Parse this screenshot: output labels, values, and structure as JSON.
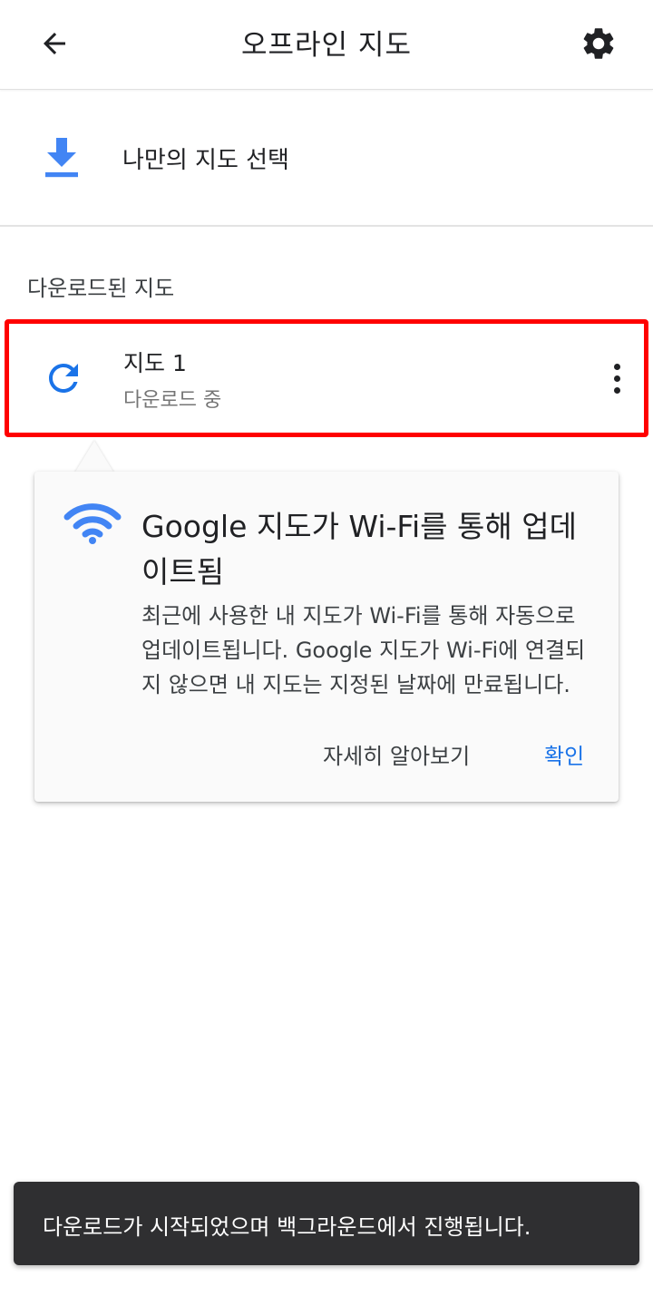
{
  "appbar": {
    "title": "오프라인 지도",
    "back_icon": "arrow-back-icon",
    "settings_icon": "gear-icon"
  },
  "select_row": {
    "icon": "download-icon",
    "label": "나만의 지도 선택"
  },
  "downloaded_section": {
    "heading": "다운로드된 지도",
    "items": [
      {
        "icon": "refresh-icon",
        "name": "지도 1",
        "status": "다운로드 중",
        "more_icon": "more-vert-icon"
      }
    ]
  },
  "info_card": {
    "icon": "wifi-icon",
    "title": "Google 지도가 Wi-Fi를 통해 업데이트됨",
    "body": "최근에 사용한 내 지도가 Wi-Fi를 통해 자동으로 업데이트됩니다. Google 지도가 Wi-Fi에 연결되지 않으면 내 지도는 지정된 날짜에 만료됩니다.",
    "learn_more_label": "자세히 알아보기",
    "confirm_label": "확인"
  },
  "snackbar": {
    "text": "다운로드가 시작되었으며 백그라운드에서 진행됩니다."
  },
  "colors": {
    "accent_blue": "#1a73e8",
    "icon_blue": "#4285f4",
    "highlight_red": "#ff0000",
    "snackbar_bg": "#2f2f31"
  }
}
